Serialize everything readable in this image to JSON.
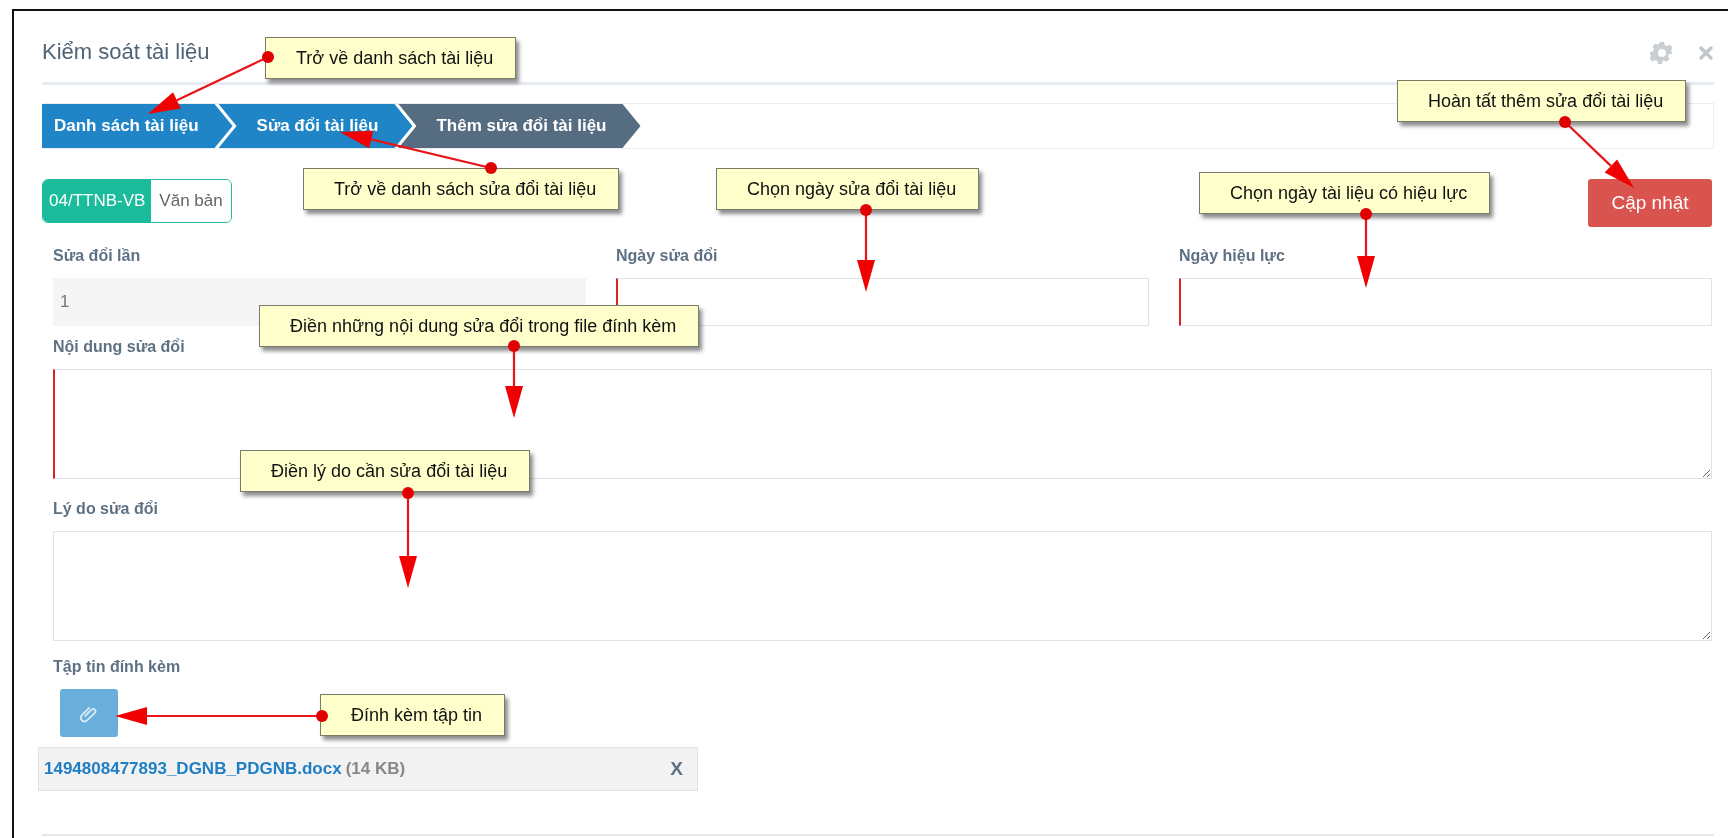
{
  "panel": {
    "title": "Kiểm soát tài liệu"
  },
  "breadcrumb": [
    {
      "label": "Danh sách tài liệu",
      "selected": false
    },
    {
      "label": "Sửa đổi tài liệu",
      "selected": false
    },
    {
      "label": "Thêm sửa đổi tài liệu",
      "selected": true
    }
  ],
  "document_tag": {
    "code": "04/TTNB-VB",
    "type": "Văn bản"
  },
  "update_button": "Cập nhật",
  "fields": [
    {
      "label": "Sửa đổi lần",
      "value": "1",
      "disabled": true,
      "required": false
    },
    {
      "label": "Ngày sửa đổi",
      "disabled": false,
      "required": true
    },
    {
      "label": "Ngày hiệu lực",
      "disabled": false,
      "required": true
    }
  ],
  "text_areas": [
    {
      "label": "Nội dung sửa đổi",
      "required": true
    },
    {
      "label": "Lý do sửa đổi",
      "required": false
    }
  ],
  "attachments": {
    "label": "Tập tin đính kèm",
    "files": [
      {
        "name": "1494808477893_DGNB_PDGNB.docx",
        "size": "(14 KB)",
        "remove": "X"
      }
    ]
  },
  "callouts": [
    {
      "text": "Trở về danh sách tài liệu"
    },
    {
      "text": "Trở về danh sách sửa đổi tài liệu"
    },
    {
      "text": "Chọn ngày sửa đổi tài liệu"
    },
    {
      "text": "Chọn ngày tài liệu có hiệu lực"
    },
    {
      "text": "Hoàn tất thêm sửa đổi tài liệu"
    },
    {
      "text": "Điền những nội dung sửa đổi trong file đính kèm"
    },
    {
      "text": "Điền lý do cần sửa đổi tài liệu"
    },
    {
      "text": "Đính kèm tập tin"
    }
  ]
}
